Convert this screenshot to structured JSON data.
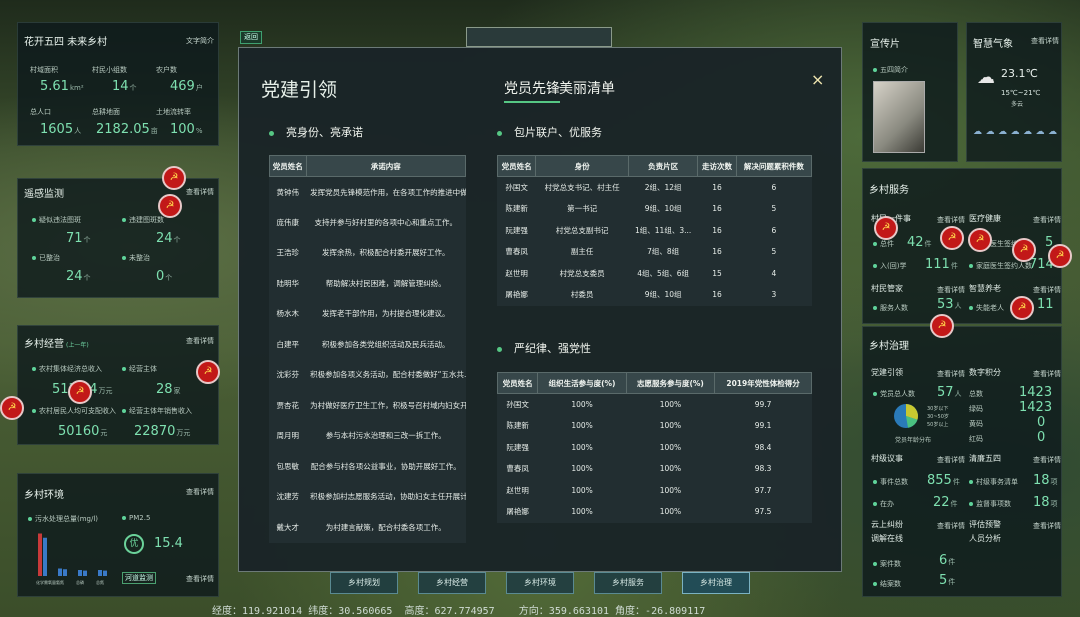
{
  "back_label": "返回",
  "left": {
    "village": {
      "title": "花开五四 未来乡村",
      "link": "文字简介",
      "stats": [
        {
          "label": "村域面积",
          "value": "5.61",
          "unit": "km²"
        },
        {
          "label": "村民小组数",
          "value": "14",
          "unit": "个"
        },
        {
          "label": "农户数",
          "value": "469",
          "unit": "户"
        },
        {
          "label": "总人口",
          "value": "1605",
          "unit": "人"
        },
        {
          "label": "总耕地面",
          "value": "2182.05",
          "unit": "亩"
        },
        {
          "label": "土地流转率",
          "value": "100",
          "unit": "%"
        }
      ]
    },
    "monitor": {
      "title": "遥感监测",
      "link": "查看详情",
      "stats": [
        {
          "label": "疑似违法图斑",
          "value": "71",
          "unit": "个"
        },
        {
          "label": "违建图斑数",
          "value": "24",
          "unit": "个"
        },
        {
          "label": "已整治",
          "value": "24",
          "unit": "个"
        },
        {
          "label": "未整治",
          "value": "0",
          "unit": "个"
        }
      ]
    },
    "economy": {
      "title": "乡村经营",
      "subtitle": "(上一年)",
      "link": "查看详情",
      "stats": [
        {
          "label": "农村集体经济总收入",
          "value": "513.74",
          "unit": "万元"
        },
        {
          "label": "经营主体",
          "value": "28",
          "unit": "家"
        },
        {
          "label": "农村居民人均可支配收入",
          "value": "50160",
          "unit": "元"
        },
        {
          "label": "经营主体年销售收入",
          "value": "22870",
          "unit": "万元"
        }
      ]
    },
    "environment": {
      "title": "乡村环境",
      "link": "查看详情",
      "water_label": "污水处理总量(mg/l)",
      "pm_label": "PM2.5",
      "pm_quality": "优",
      "pm_value": "15.4",
      "monitor_label": "河道监测",
      "more_label": "查看详情",
      "bars": [
        {
          "label": "化学需氧量",
          "value": 0.85
        },
        {
          "label": "氨氮",
          "value": 0.15
        },
        {
          "label": "总磷",
          "value": 0.12
        },
        {
          "label": "总氮",
          "value": 0.12
        }
      ]
    }
  },
  "right": {
    "publicity": {
      "title": "宣传片",
      "item": "五四简介"
    },
    "weather": {
      "title": "智慧气象",
      "link": "查看详情",
      "temp": "23.1℃",
      "range": "15℃~21℃",
      "cond": "多云",
      "days": [
        "",
        "",
        "",
        "",
        "",
        "",
        ""
      ]
    },
    "service": {
      "title": "乡村服务",
      "blocks": [
        {
          "title": "村民一件事",
          "link": "查看详情",
          "items": [
            {
              "label": "总件",
              "value": "42",
              "unit": "件"
            },
            {
              "label": "入(回)学",
              "value": "111",
              "unit": "件"
            }
          ]
        },
        {
          "title": "医疗健康",
          "link": "查看详情",
          "items": [
            {
              "label": "家庭医生签约",
              "value": "5",
              "unit": "人"
            },
            {
              "label": "家庭医生签约人数",
              "value": "714",
              "unit": "人"
            }
          ]
        },
        {
          "title": "村民管家",
          "link": "查看详情",
          "items": [
            {
              "label": "服务人数",
              "value": "53",
              "unit": "人"
            }
          ]
        },
        {
          "title": "智慧养老",
          "link": "查看详情",
          "items": [
            {
              "label": "失能老人",
              "value": "11",
              "unit": "人"
            }
          ]
        }
      ]
    },
    "governance": {
      "title": "乡村治理",
      "party": {
        "title": "党建引领",
        "link": "查看详情",
        "count_label": "党员总人数",
        "count": "57",
        "count_unit": "人",
        "legend": [
          "30岁以下",
          "30~50岁",
          "50岁以上"
        ],
        "chart_label": "党员年龄分布"
      },
      "points": {
        "title": "数字积分",
        "link": "查看详情",
        "total_label": "总数",
        "total": "1423",
        "items": [
          {
            "label": "绿码",
            "value": "1423"
          },
          {
            "label": "黄码",
            "value": "0"
          },
          {
            "label": "红码",
            "value": "0"
          }
        ]
      },
      "village_affairs": {
        "title": "村级议事",
        "link": "查看详情",
        "items": [
          {
            "label": "事件总数",
            "value": "855",
            "unit": "件"
          },
          {
            "label": "在办",
            "value": "22",
            "unit": "件"
          }
        ]
      },
      "clean": {
        "title": "清廉五四",
        "link": "查看详情",
        "items": [
          {
            "label": "村级事务清单",
            "value": "18",
            "unit": "项"
          },
          {
            "label": "监督事项数",
            "value": "18",
            "unit": "项"
          }
        ]
      },
      "cloud": {
        "title": "云上纠纷",
        "title2": "调解在线",
        "link": "查看详情",
        "items": [
          {
            "label": "案件数",
            "value": "6",
            "unit": "件"
          },
          {
            "label": "结案数",
            "value": "5",
            "unit": "件"
          }
        ]
      },
      "risk": {
        "title": "评估预警",
        "title2": "人员分析",
        "link": "查看详情"
      }
    }
  },
  "modal": {
    "title": "党建引领",
    "tabs": [
      "党员先锋",
      "美丽清单"
    ],
    "close": "×",
    "sec1": "亮身份、亮承诺",
    "sec2": "包片联户、优服务",
    "sec3": "严纪律、强党性",
    "t1_headers": [
      "党员姓名",
      "承诺内容"
    ],
    "t1_rows": [
      [
        "黄钟伟",
        "发挥党员先锋模范作用，在各项工作的推进中做..."
      ],
      [
        "庞伟康",
        "支持并参与好村里的各项中心和重点工作。"
      ],
      [
        "王浩珍",
        "发挥余热，积极配合村委开展好工作。"
      ],
      [
        "陆明华",
        "帮助解决村民困难，调解管理纠纷。"
      ],
      [
        "杨水木",
        "发挥老干部作用，为村提合理化建议。"
      ],
      [
        "白建平",
        "积极参加各类党组织活动及民兵活动。"
      ],
      [
        "沈彩芬",
        "积极参加各项义务活动，配合村委做好“五水共..."
      ],
      [
        "贾杏花",
        "为村做好医疗卫生工作，积极号召村域内妇女开..."
      ],
      [
        "周月明",
        "参与本村污水治理和三改一拆工作。"
      ],
      [
        "包思敏",
        "配合参与村各项公益事业，协助开展好工作。"
      ],
      [
        "沈建芳",
        "积极参加村志愿服务活动，协助妇女主任开展计..."
      ],
      [
        "戴大才",
        "为村建言献策，配合村委各项工作。"
      ]
    ],
    "t2_headers": [
      "党员姓名",
      "身份",
      "负责片区",
      "走访次数",
      "解决问题累积件数"
    ],
    "t2_rows": [
      [
        "孙国文",
        "村党总支书记、村主任",
        "2组、12组",
        "16",
        "6"
      ],
      [
        "陈建新",
        "第一书记",
        "9组、10组",
        "16",
        "5"
      ],
      [
        "阮建强",
        "村党总支副书记",
        "1组、11组、3...",
        "16",
        "6"
      ],
      [
        "曹春凤",
        "副主任",
        "7组、8组",
        "16",
        "5"
      ],
      [
        "赵世明",
        "村党总支委员",
        "4组、5组、6组",
        "15",
        "4"
      ],
      [
        "屠艳娜",
        "村委员",
        "9组、10组",
        "16",
        "3"
      ]
    ],
    "t3_headers": [
      "党员姓名",
      "组织生活参与度(%)",
      "志愿服务参与度(%)",
      "2019年党性体检得分"
    ],
    "t3_rows": [
      [
        "孙国文",
        "100%",
        "100%",
        "99.7"
      ],
      [
        "陈建新",
        "100%",
        "100%",
        "99.1"
      ],
      [
        "阮建强",
        "100%",
        "100%",
        "98.4"
      ],
      [
        "曹春凤",
        "100%",
        "100%",
        "98.3"
      ],
      [
        "赵世明",
        "100%",
        "100%",
        "97.7"
      ],
      [
        "屠艳娜",
        "100%",
        "100%",
        "97.5"
      ]
    ]
  },
  "nav": [
    "乡村规划",
    "乡村经营",
    "乡村环境",
    "乡村服务",
    "乡村治理"
  ],
  "coords": {
    "lng_label": "经度：",
    "lng": "119.921014",
    "lat_label": "纬度：",
    "lat": "30.560665",
    "alt_label": "高度：",
    "alt": "627.774957",
    "dir_label": "方向：",
    "dir": "359.663101",
    "angle_label": "角度：",
    "angle": "-26.809117"
  },
  "colors": {
    "accent": "#56c784",
    "value": "#7ee0b0",
    "flag": "#c21818"
  }
}
